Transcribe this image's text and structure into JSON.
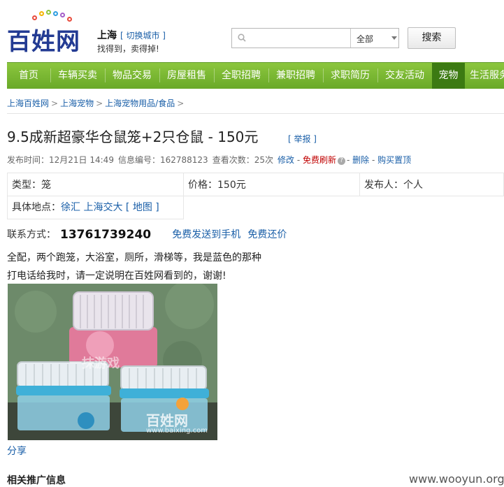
{
  "header": {
    "logo_text": "百姓网",
    "city": "上海",
    "switch_city": "[ 切换城市 ]",
    "slogan": "找得到，卖得掉!",
    "search": {
      "placeholder": "",
      "category": "全部",
      "button": "搜索"
    }
  },
  "nav": {
    "items": [
      "首页",
      "车辆买卖",
      "物品交易",
      "房屋租售",
      "全职招聘",
      "兼职招聘",
      "求职简历",
      "交友活动",
      "宠物",
      "生活服务"
    ],
    "active": "宠物",
    "colors": {
      "bar": "#7ab632",
      "active": "#3c7a12"
    }
  },
  "breadcrumb": [
    "上海百姓网",
    "上海宠物",
    "上海宠物用品/食品"
  ],
  "breadcrumb_sep": ">",
  "listing": {
    "title": "9.5成新超豪华仓鼠笼+2只仓鼠 - 150元",
    "report": "[ 举报 ]",
    "meta": {
      "post_time_label": "发布时间：",
      "post_time": "12月21日 14:49",
      "id_label": "信息编号：",
      "id": "162788123",
      "views_label": "查看次数：",
      "views": "25次",
      "edit": "修改",
      "refresh": "免费刷新",
      "delete": "删除",
      "buy_top": "购买置顶"
    },
    "info": {
      "type": "类型：笼",
      "price": "价格：150元",
      "poster": "发布人：个人",
      "location_label": "具体地点：",
      "location_district": "徐汇",
      "location_place": "上海交大",
      "map": "[ 地图 ]"
    },
    "contact": {
      "label": "联系方式：",
      "phone": "13761739240",
      "send_to_phone": "免费发送到手机",
      "bargain": "免费还价"
    },
    "description": [
      "全配，两个跑笼，大浴室，厕所，滑梯等，我是蓝色的那种",
      "打电话给我时，请一定说明在百姓网看到的，谢谢!"
    ],
    "photo": {
      "watermark_logo": "百姓网",
      "watermark_url": "www.baixing.com",
      "watermark_top": "一抹游戏"
    },
    "share": "分享"
  },
  "related_title": "相关推广信息",
  "site_watermark": "www.wooyun.org"
}
